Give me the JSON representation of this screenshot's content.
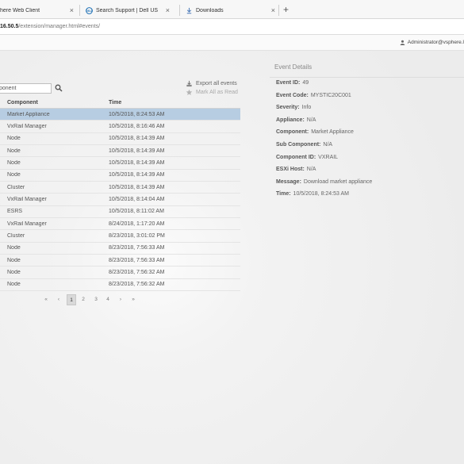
{
  "browser": {
    "tabs": [
      {
        "label": "here Web Client"
      },
      {
        "label": "Search Support | Dell US"
      },
      {
        "label": "Downloads"
      }
    ],
    "new_tab": "+",
    "close_glyph": "×",
    "url_host": "16.50.5",
    "url_path": "/extension/manager.html#events/"
  },
  "header": {
    "user": "Administrator@vsphere.l"
  },
  "filter": {
    "value": "ponent",
    "search_icon": "search-icon"
  },
  "actions": {
    "export": "Export all events",
    "mark_read": "Mark All as Read"
  },
  "table": {
    "headers": {
      "component": "Component",
      "time": "Time"
    },
    "rows": [
      {
        "component": "Market Appliance",
        "time": "10/5/2018, 8:24:53 AM"
      },
      {
        "component": "VxRail Manager",
        "time": "10/5/2018, 8:16:46 AM"
      },
      {
        "component": "Node",
        "time": "10/5/2018, 8:14:39 AM"
      },
      {
        "component": "Node",
        "time": "10/5/2018, 8:14:39 AM"
      },
      {
        "component": "Node",
        "time": "10/5/2018, 8:14:39 AM"
      },
      {
        "component": "Node",
        "time": "10/5/2018, 8:14:39 AM"
      },
      {
        "component": "Cluster",
        "time": "10/5/2018, 8:14:39 AM"
      },
      {
        "component": "VxRail Manager",
        "time": "10/5/2018, 8:14:04 AM"
      },
      {
        "component": "ESRS",
        "time": "10/5/2018, 8:11:02 AM"
      },
      {
        "component": "VxRail Manager",
        "time": "8/24/2018, 1:17:20 AM"
      },
      {
        "component": "Cluster",
        "time": "8/23/2018, 3:01:02 PM"
      },
      {
        "component": "Node",
        "time": "8/23/2018, 7:56:33 AM"
      },
      {
        "component": "Node",
        "time": "8/23/2018, 7:56:33 AM"
      },
      {
        "component": "Node",
        "time": "8/23/2018, 7:56:32 AM"
      },
      {
        "component": "Node",
        "time": "8/23/2018, 7:56:32 AM"
      }
    ]
  },
  "pagination": {
    "first": "«",
    "prev": "‹",
    "pages": [
      "1",
      "2",
      "3",
      "4"
    ],
    "current": "1",
    "next": "›",
    "last": "»"
  },
  "details": {
    "title": "Event Details",
    "fields": [
      {
        "label": "Event ID:",
        "value": "49"
      },
      {
        "label": "Event Code:",
        "value": "MYSTIC20C001"
      },
      {
        "label": "Severity:",
        "value": "Info"
      },
      {
        "label": "Appliance:",
        "value": "N/A"
      },
      {
        "label": "Component:",
        "value": "Market Appliance"
      },
      {
        "label": "Sub Component:",
        "value": "N/A"
      },
      {
        "label": "Component ID:",
        "value": "VXRAIL"
      },
      {
        "label": "ESXi Host:",
        "value": "N/A"
      },
      {
        "label": "Message:",
        "value": "Download market appliance"
      },
      {
        "label": "Time:",
        "value": "10/5/2018, 8:24:53 AM"
      }
    ]
  },
  "colors": {
    "selected_row": "#b7cde2",
    "dell_blue": "#1b6fb5"
  }
}
